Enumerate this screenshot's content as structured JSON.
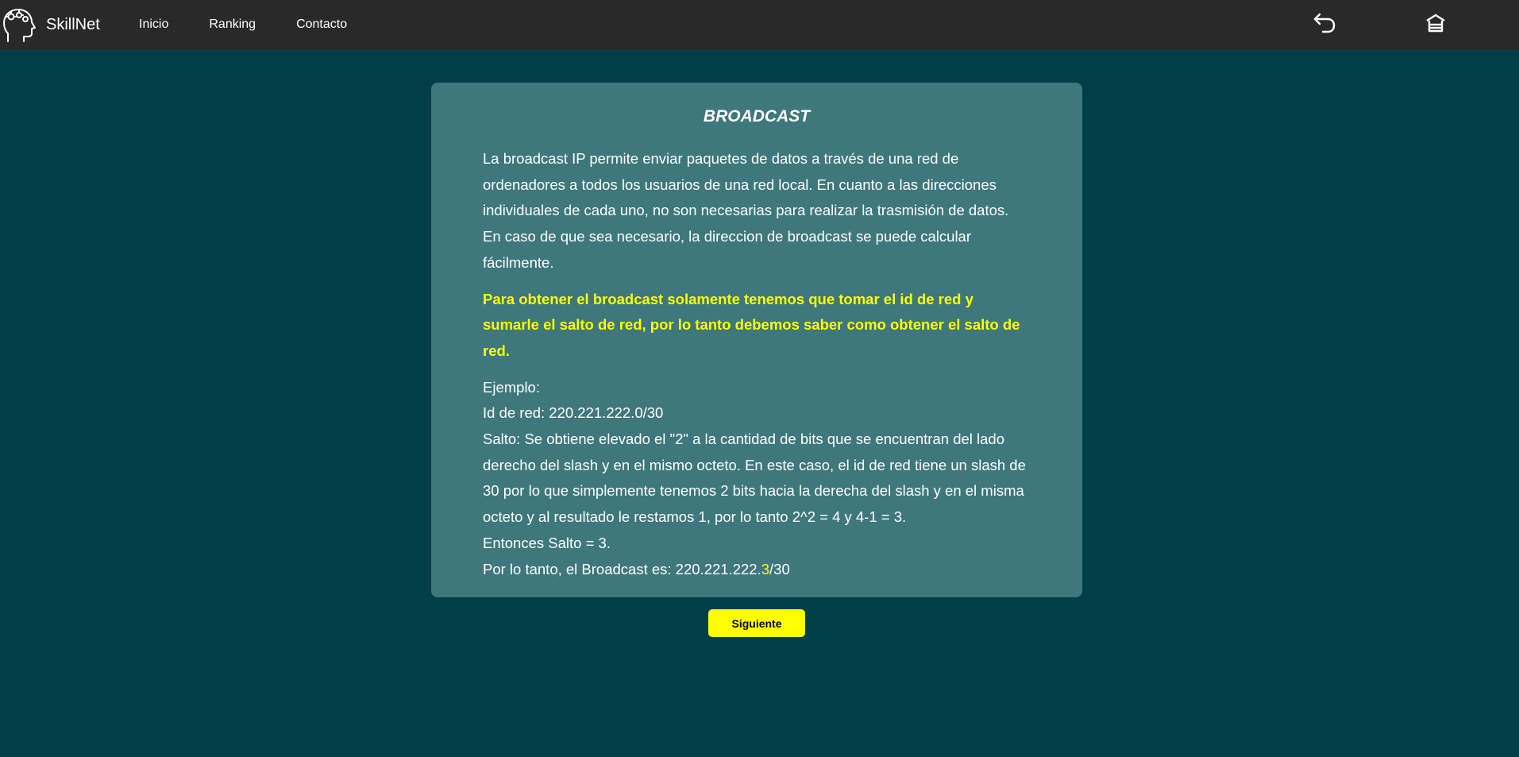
{
  "navbar": {
    "brand": "SkillNet",
    "links": [
      "Inicio",
      "Ranking",
      "Contacto"
    ],
    "icons": {
      "brand_logo": "head-gears-icon",
      "back": "undo-arrow-icon",
      "home": "home-icon"
    },
    "colors": {
      "background": "#292929",
      "text": "#ffffff"
    }
  },
  "card": {
    "title": "BROADCAST",
    "intro": "La broadcast IP permite enviar paquetes de datos a través de una red de ordenadores a todos los usuarios de una red local. En cuanto a las direcciones individuales de cada uno, no son necesarias para realizar la trasmisión de datos. En caso de que sea necesario, la direccion de broadcast se puede calcular fácilmente.",
    "highlight": "Para obtener el broadcast solamente tenemos que tomar el id de red y sumarle el salto de red, por lo tanto debemos saber como obtener el salto de red.",
    "example_label": "Ejemplo:",
    "network_id": "Id de red: 220.221.222.0/30",
    "jump_explanation": "Salto: Se obtiene elevado el \"2\" a la cantidad de bits que se encuentran del lado derecho del slash y en el mismo octeto. En este caso, el id de red tiene un slash de 30 por lo que simplemente tenemos 2 bits hacia la derecha del slash y en el misma octeto y al resultado le restamos 1, por lo tanto 2^2 = 4 y 4-1 = 3.",
    "jump_result": "Entonces Salto = 3.",
    "broadcast_prefix": "Por lo tanto, el Broadcast es: 220.221.222.",
    "broadcast_highlight": "3",
    "broadcast_suffix": "/30"
  },
  "next_button": "Siguiente",
  "colors": {
    "page_background": "#003f48",
    "card_background": "#3e777c",
    "accent": "#ffff00"
  }
}
